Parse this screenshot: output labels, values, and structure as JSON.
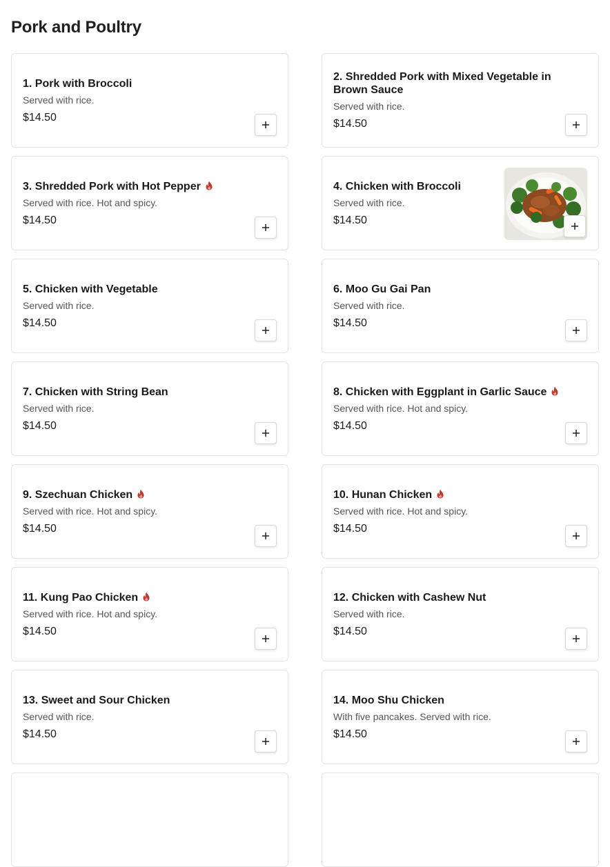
{
  "section": {
    "title": "Pork and Poultry"
  },
  "colors": {
    "spicy": "#c0392b",
    "border": "#e3e3e3"
  },
  "items": [
    {
      "name": "1. Pork with Broccoli",
      "description": "Served with rice.",
      "price": "$14.50",
      "spicy": false,
      "image": false
    },
    {
      "name": "2. Shredded Pork with Mixed Vegetable in Brown Sauce",
      "description": "Served with rice.",
      "price": "$14.50",
      "spicy": false,
      "image": false
    },
    {
      "name": "3. Shredded Pork with Hot Pepper",
      "description": "Served with rice. Hot and spicy.",
      "price": "$14.50",
      "spicy": true,
      "image": false
    },
    {
      "name": "4. Chicken with Broccoli",
      "description": "Served with rice.",
      "price": "$14.50",
      "spicy": false,
      "image": true
    },
    {
      "name": "5. Chicken with Vegetable",
      "description": "Served with rice.",
      "price": "$14.50",
      "spicy": false,
      "image": false
    },
    {
      "name": "6. Moo Gu Gai Pan",
      "description": "Served with rice.",
      "price": "$14.50",
      "spicy": false,
      "image": false
    },
    {
      "name": "7. Chicken with String Bean",
      "description": "Served with rice.",
      "price": "$14.50",
      "spicy": false,
      "image": false
    },
    {
      "name": "8. Chicken with Eggplant in Garlic Sauce",
      "description": "Served with rice. Hot and spicy.",
      "price": "$14.50",
      "spicy": true,
      "image": false
    },
    {
      "name": "9. Szechuan Chicken",
      "description": "Served with rice. Hot and spicy.",
      "price": "$14.50",
      "spicy": true,
      "image": false
    },
    {
      "name": "10. Hunan Chicken",
      "description": "Served with rice. Hot and spicy.",
      "price": "$14.50",
      "spicy": true,
      "image": false
    },
    {
      "name": "11. Kung Pao Chicken",
      "description": "Served with rice. Hot and spicy.",
      "price": "$14.50",
      "spicy": true,
      "image": false
    },
    {
      "name": "12. Chicken with Cashew Nut",
      "description": "Served with rice.",
      "price": "$14.50",
      "spicy": false,
      "image": false
    },
    {
      "name": "13. Sweet and Sour Chicken",
      "description": "Served with rice.",
      "price": "$14.50",
      "spicy": false,
      "image": false
    },
    {
      "name": "14. Moo Shu Chicken",
      "description": "With five pancakes. Served with rice.",
      "price": "$14.50",
      "spicy": false,
      "image": false
    },
    {
      "name": "",
      "description": "",
      "price": "",
      "spicy": false,
      "image": false
    },
    {
      "name": "",
      "description": "",
      "price": "",
      "spicy": false,
      "image": false
    }
  ]
}
